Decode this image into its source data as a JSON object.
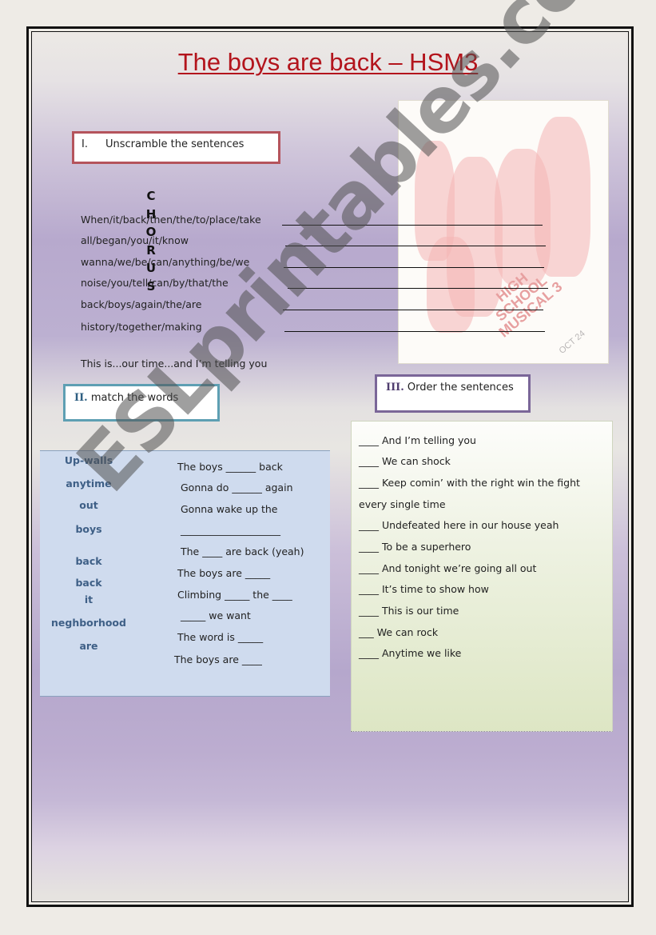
{
  "title": "The boys are back – HSM3",
  "section1": {
    "number": "I.",
    "heading": "Unscramble the sentences",
    "vertical_label": [
      "C",
      "H",
      "O",
      "R",
      "U",
      "S"
    ],
    "items": [
      "When/it/back/then/the/to/place/take",
      "all/began/you/it/know",
      "wanna/we/be/can/anything/be/we",
      "noise/you/tell/can/by/that/the",
      "back/boys/again/the/are",
      "history/together/making"
    ],
    "closing_line": "This is...our time...and I’m telling you"
  },
  "poster": {
    "logo_lines": [
      "HIGH",
      "SCHOOL",
      "MUSICAL 3"
    ],
    "date": "OCT 24"
  },
  "section2": {
    "number": "II.",
    "heading": " match the words",
    "words": [
      "Up-walls",
      "anytime",
      "out",
      "boys",
      "back",
      "back",
      "it",
      "neghborhood",
      "are"
    ],
    "lyrics": [
      "The boys ______  back",
      "Gonna do ______ again",
      "Gonna wake up the",
      "____________________",
      "The ____ are back (yeah)",
      "The boys are _____",
      "Climbing _____ the ____",
      "_____  we want",
      "The word is _____",
      "The boys are ____"
    ]
  },
  "section3": {
    "number": "III.",
    "heading": " Order the sentences",
    "items": [
      "____ And I’m telling you",
      "____  We can shock",
      "____  Keep comin’ with the right win the fight",
      "every single time",
      "____  Undefeated here in our house yeah",
      "____ To be a superhero",
      "____  And tonight we’re going all out",
      "____ It’s time to show how",
      "____  This is our time",
      "___ We can rock",
      "____ Anytime  we like"
    ]
  },
  "watermark": "ESLprintables.com",
  "colors": {
    "title": "#b3141c",
    "box1_border": "#b5545c",
    "box2_border": "#5e9fb3",
    "box3_border": "#7a6698",
    "match_words": "#3e5f86",
    "match_bg": "#cfdbee"
  }
}
